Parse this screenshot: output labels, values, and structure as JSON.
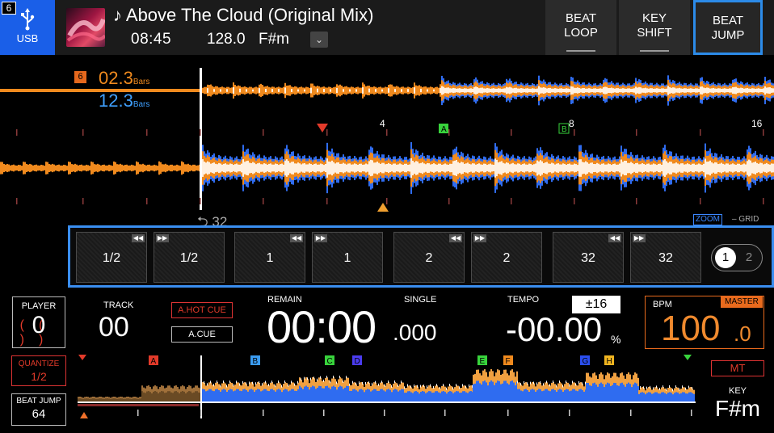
{
  "header": {
    "deck_number": "6",
    "source_label": "USB",
    "track_title": "♪ Above The Cloud (Original Mix)",
    "track_time": "08:45",
    "track_bpm": "128.0",
    "track_key": "F#m",
    "dropdown_icon": "chevron-down-icon",
    "modes": [
      {
        "label_1": "BEAT",
        "label_2": "LOOP",
        "active": false
      },
      {
        "label_1": "KEY",
        "label_2": "SHIFT",
        "active": false
      },
      {
        "label_1": "BEAT",
        "label_2": "JUMP",
        "active": true
      }
    ]
  },
  "waveform": {
    "cue_badge": "6",
    "bars_orange": "02.3",
    "bars_blue": "12.3",
    "bars_unit": "Bars",
    "beat_marks": [
      "4",
      "8",
      "16"
    ],
    "cue_a": "A",
    "cue_b": "B",
    "loop_indicator": "32",
    "zoom_label": "ZOOM",
    "grid_label": "– GRID",
    "colors": {
      "orange": "#f08a1e",
      "blue": "#2f6cf0",
      "white": "#fff0e0"
    }
  },
  "beat_jump": {
    "buttons": [
      {
        "label": "1/2",
        "dir": "back"
      },
      {
        "label": "1/2",
        "dir": "fwd"
      },
      {
        "label": "1",
        "dir": "back"
      },
      {
        "label": "1",
        "dir": "fwd"
      },
      {
        "label": "2",
        "dir": "back"
      },
      {
        "label": "2",
        "dir": "fwd"
      },
      {
        "label": "32",
        "dir": "back"
      },
      {
        "label": "32",
        "dir": "fwd"
      }
    ],
    "back_glyph": "◀◀",
    "fwd_glyph": "▶▶",
    "pages": [
      "1",
      "2"
    ],
    "active_page": "1"
  },
  "status": {
    "player_label": "PLAYER",
    "player_number": "0",
    "quantize_label": "QUANTIZE",
    "quantize_value": "1/2",
    "beat_jump_label": "BEAT JUMP",
    "beat_jump_value": "64",
    "track_label": "TRACK",
    "track_value": "00",
    "hot_cue_label": "A.HOT CUE",
    "auto_cue_label": "A.CUE",
    "remain_label": "REMAIN",
    "single_label": "SINGLE",
    "time_main": "00:00",
    "time_ms": ".000",
    "tempo_label": "TEMPO",
    "tempo_range": "±16",
    "tempo_value": "-00.00",
    "tempo_unit": "%",
    "bpm_label": "BPM",
    "master_label": "MASTER",
    "bpm_value": "100",
    "bpm_decimal": ".0",
    "mt_label": "MT",
    "key_label": "KEY",
    "key_value": "F#m"
  },
  "overview": {
    "cues": [
      {
        "label": "A",
        "color": "#e23a2a"
      },
      {
        "label": "B",
        "color": "#3a9bf0"
      },
      {
        "label": "C",
        "color": "#38d33c"
      },
      {
        "label": "D",
        "color": "#4b3cf0"
      },
      {
        "label": "E",
        "color": "#38d33c"
      },
      {
        "label": "F",
        "color": "#f08a1e"
      },
      {
        "label": "G",
        "color": "#2a4ef0"
      },
      {
        "label": "H",
        "color": "#f0b420"
      }
    ]
  }
}
